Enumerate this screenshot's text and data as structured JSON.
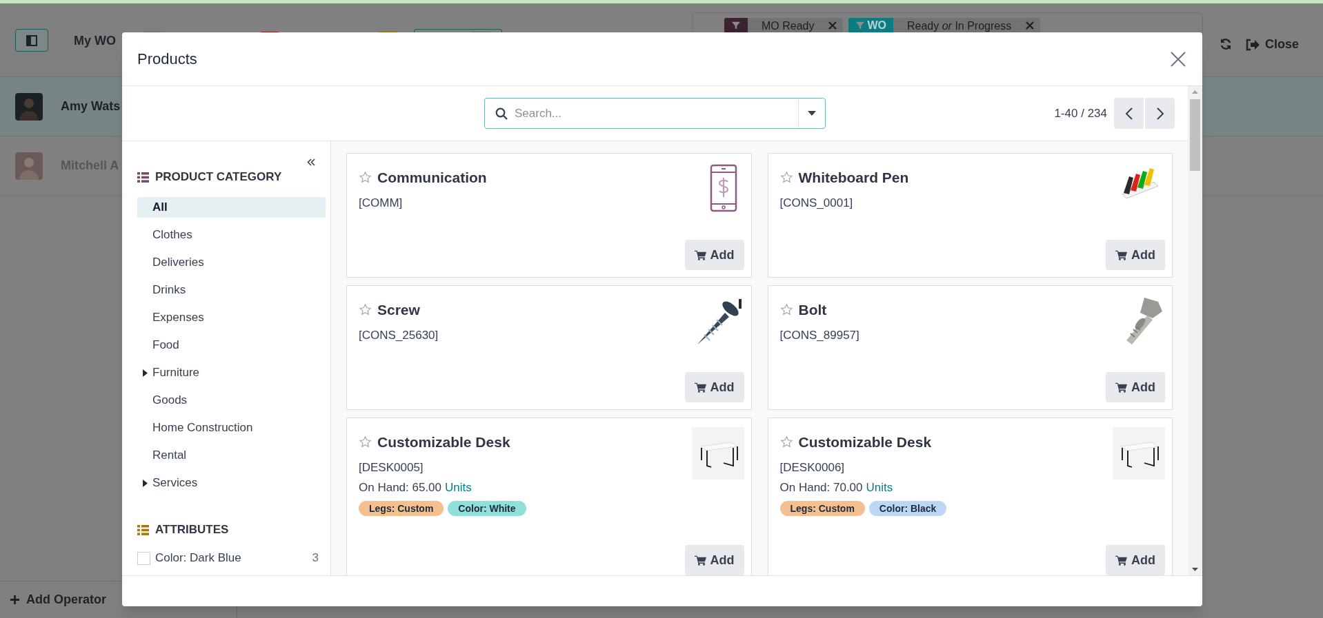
{
  "app_bar": {
    "title": "My WO",
    "badges": [
      {
        "color": "#6a6a6a"
      },
      {
        "color": "#8c1d1d"
      },
      {
        "color": "#86710f"
      }
    ],
    "facets": [
      {
        "label": "MO Ready",
        "color": "#3b2333"
      },
      {
        "tag": "WO",
        "label": "Ready *or* In Progress",
        "color": "#0c7c82"
      }
    ],
    "close_button": "Close"
  },
  "operators": [
    {
      "name": "Amy Wats",
      "selected": true
    },
    {
      "name": "Mitchell A",
      "selected": false
    }
  ],
  "add_operator": "Add Operator",
  "modal": {
    "title": "Products",
    "search": {
      "placeholder": "Search..."
    },
    "pager": "1-40 / 234",
    "categories_heading": "PRODUCT CATEGORY",
    "categories": [
      {
        "label": "All",
        "selected": true,
        "kind": "leaf"
      },
      {
        "label": "Clothes",
        "selected": false,
        "kind": "leaf"
      },
      {
        "label": "Deliveries",
        "selected": false,
        "kind": "leaf"
      },
      {
        "label": "Drinks",
        "selected": false,
        "kind": "leaf"
      },
      {
        "label": "Expenses",
        "selected": false,
        "kind": "leaf"
      },
      {
        "label": "Food",
        "selected": false,
        "kind": "leaf"
      },
      {
        "label": "Furniture",
        "selected": false,
        "kind": "group",
        "expanded": false
      },
      {
        "label": "Goods",
        "selected": false,
        "kind": "leaf"
      },
      {
        "label": "Home Construction",
        "selected": false,
        "kind": "leaf"
      },
      {
        "label": "Rental",
        "selected": false,
        "kind": "leaf"
      },
      {
        "label": "Services",
        "selected": false,
        "kind": "group",
        "expanded": false
      }
    ],
    "attributes_heading": "ATTRIBUTES",
    "attributes": [
      {
        "label": "Color: Dark Blue",
        "count": "3",
        "checked": false
      }
    ],
    "products": [
      {
        "name": "Communication",
        "code": "[COMM]",
        "favorite": false,
        "kind": "icon",
        "button": "Add"
      },
      {
        "name": "Whiteboard Pen",
        "code": "[CONS_0001]",
        "favorite": false,
        "kind": "picture",
        "button": "Add"
      },
      {
        "name": "Screw",
        "code": "[CONS_25630]",
        "favorite": false,
        "kind": "picture",
        "button": "Add"
      },
      {
        "name": "Bolt",
        "code": "[CONS_89957]",
        "favorite": false,
        "kind": "picture",
        "button": "Add"
      },
      {
        "name": "Customizable Desk",
        "code": "[DESK0005]",
        "stock": "On Hand: 65.00",
        "unit": "Units",
        "favorite": false,
        "kind": "picture",
        "button": "Add",
        "tags": [
          {
            "label": "Legs: Custom",
            "color": "#f4c08f"
          },
          {
            "label": "Color: White",
            "color": "#8ee0d9"
          }
        ]
      },
      {
        "name": "Customizable Desk",
        "code": "[DESK0006]",
        "stock": "On Hand: 70.00",
        "unit": "Units",
        "favorite": false,
        "kind": "picture",
        "button": "Add",
        "tags": [
          {
            "label": "Legs: Custom",
            "color": "#f4c08f"
          },
          {
            "label": "Color: Black",
            "color": "#bcd7f5"
          }
        ]
      }
    ]
  }
}
